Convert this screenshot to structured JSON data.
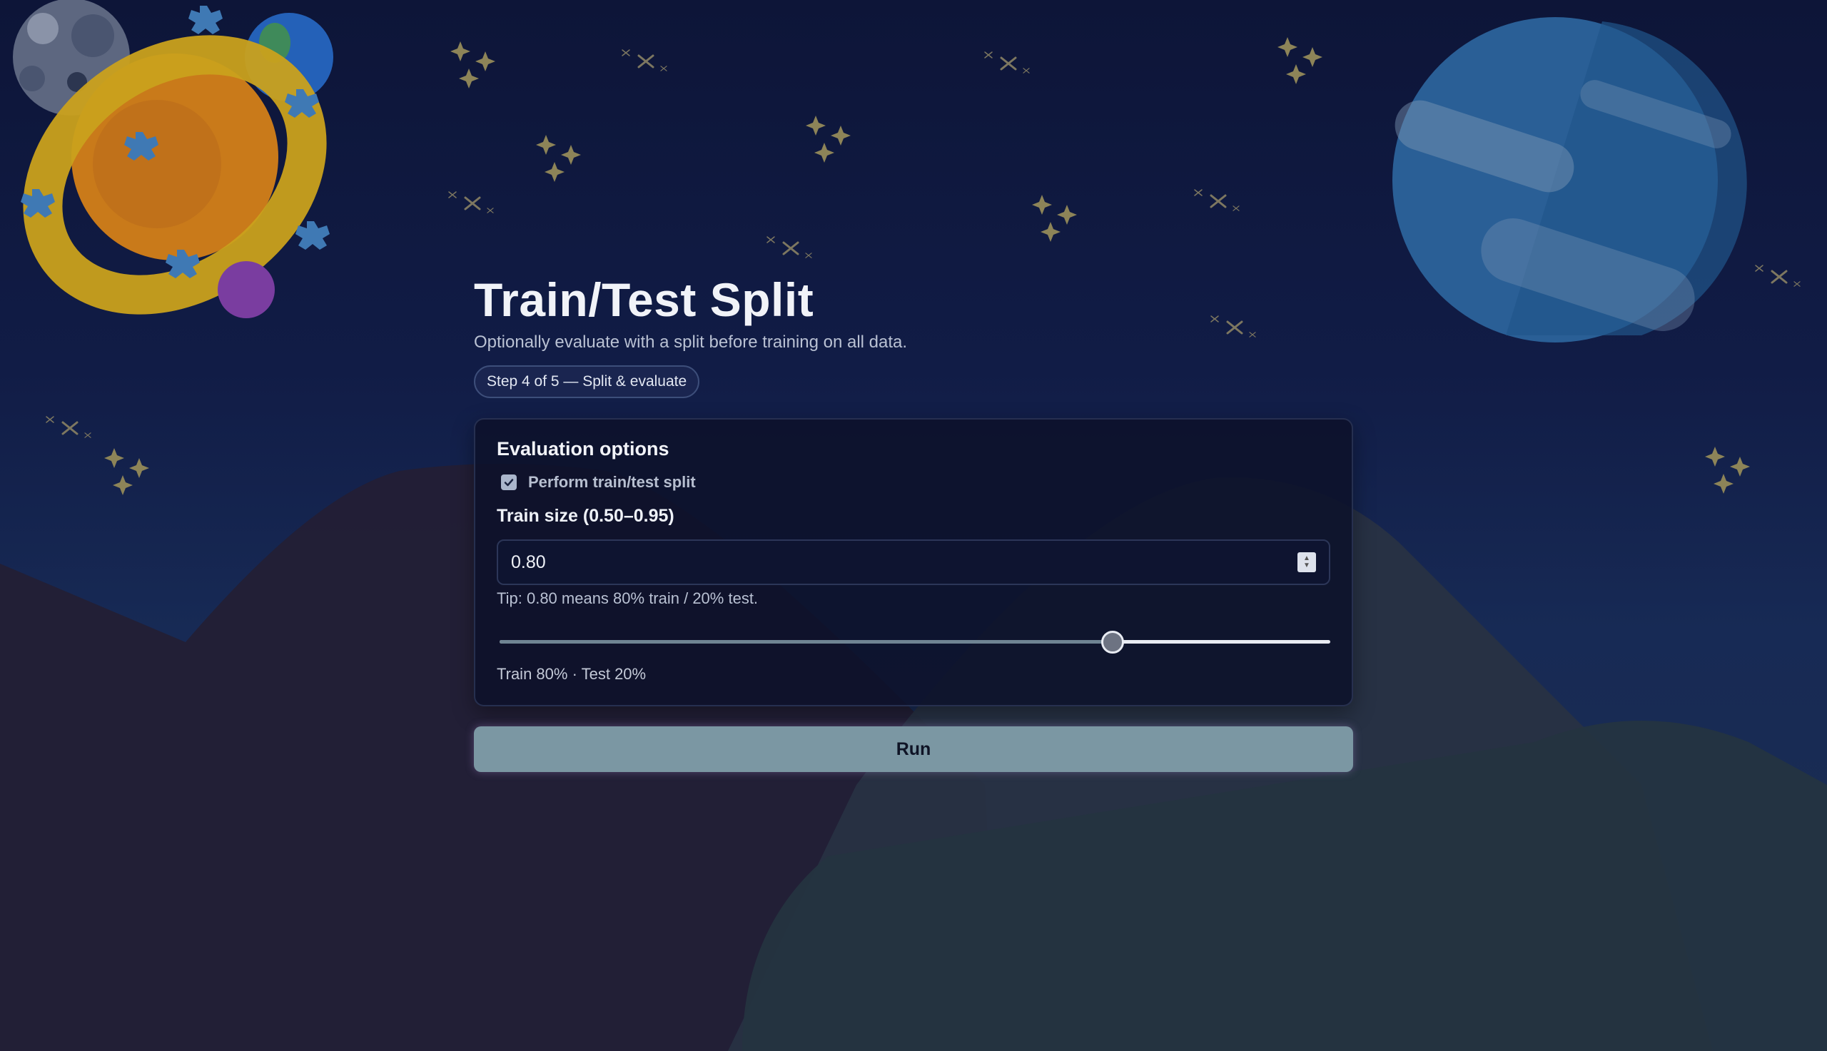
{
  "page": {
    "title": "Train/Test Split",
    "subtitle": "Optionally evaluate with a split before training on all data.",
    "step_badge": "Step 4 of 5 — Split & evaluate"
  },
  "card": {
    "title": "Evaluation options",
    "split_checkbox": {
      "label": "Perform train/test split",
      "checked": true
    },
    "train_size": {
      "label": "Train size (0.50–0.95)",
      "value": "0.80",
      "tip": "Tip: 0.80 means 80% train / 20% test.",
      "min": 0.5,
      "max": 0.95,
      "slider_value": 0.8
    },
    "split_summary": "Train 80% · Test 20%"
  },
  "actions": {
    "run_label": "Run"
  },
  "colors": {
    "background": "#0d1538",
    "card": "#0c112a",
    "accent_button": "#7b97a3",
    "slider_fill": "#6f8493"
  }
}
